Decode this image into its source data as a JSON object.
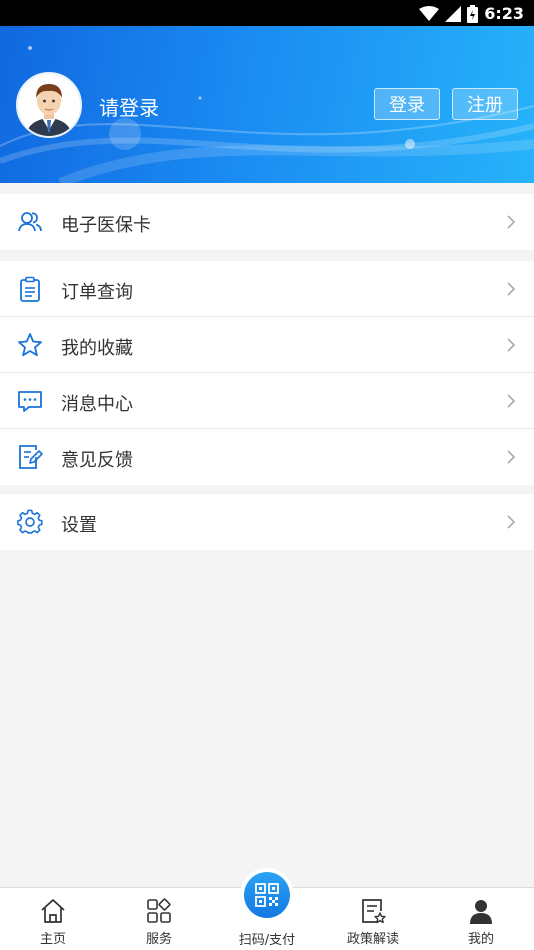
{
  "status_bar": {
    "time": "6:23"
  },
  "header": {
    "user_name": "请登录",
    "login_label": "登录",
    "register_label": "注册"
  },
  "menu": {
    "group1": [
      {
        "label": "电子医保卡",
        "icon": "people-icon"
      }
    ],
    "group2": [
      {
        "label": "订单查询",
        "icon": "clipboard-icon"
      },
      {
        "label": "我的收藏",
        "icon": "star-icon"
      },
      {
        "label": "消息中心",
        "icon": "message-icon"
      },
      {
        "label": "意见反馈",
        "icon": "feedback-icon"
      }
    ],
    "group3": [
      {
        "label": "设置",
        "icon": "gear-icon"
      }
    ]
  },
  "tabbar": {
    "items": [
      {
        "label": "主页",
        "icon": "home-icon"
      },
      {
        "label": "服务",
        "icon": "grid-icon"
      },
      {
        "label": "扫码/支付",
        "icon": "qr-code-icon"
      },
      {
        "label": "政策解读",
        "icon": "document-star-icon"
      },
      {
        "label": "我的",
        "icon": "person-icon"
      }
    ]
  },
  "colors": {
    "accent": "#1a8bf2",
    "header_start": "#1168e0",
    "header_end": "#27b3fa",
    "icon_blue": "#1a73d9"
  }
}
